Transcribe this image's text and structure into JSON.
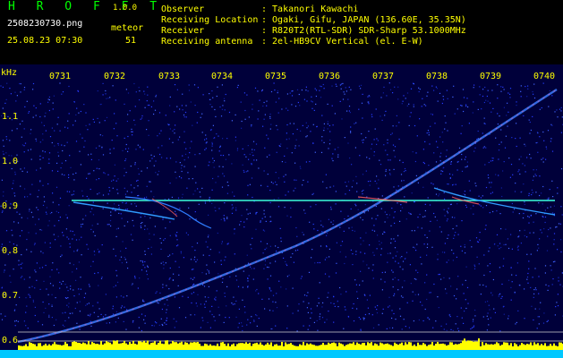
{
  "header": {
    "brand": "H R O F F T",
    "version": "1.0.0",
    "filename": "2508230730.png",
    "meteor_label": "meteor",
    "timestamp": "25.08.23 07:30",
    "meteor_count": "51"
  },
  "info": [
    {
      "label": "Observer",
      "value": ": Takanori Kawachi"
    },
    {
      "label": "Receiving Location",
      "value": ": Ogaki, Gifu, JAPAN (136.60E, 35.35N)"
    },
    {
      "label": "Receiver",
      "value": ": R820T2(RTL-SDR) SDR-Sharp 53.1000MHz"
    },
    {
      "label": "Receiving antenna",
      "value": ": 2el-HB9CV Vertical (el. E-W)"
    }
  ],
  "axis": {
    "unit": "kHz",
    "time_ticks": [
      "0731",
      "0732",
      "0733",
      "0734",
      "0735",
      "0736",
      "0737",
      "0738",
      "0739",
      "0740"
    ],
    "freq_ticks": [
      "1.1",
      "1.0",
      "0.9",
      "0.8",
      "0.7",
      "0.6"
    ]
  },
  "colors": {
    "background": "#00003a",
    "trace": "#4488ff",
    "yellow": "#ffff00",
    "cyan": "#00ffff"
  }
}
